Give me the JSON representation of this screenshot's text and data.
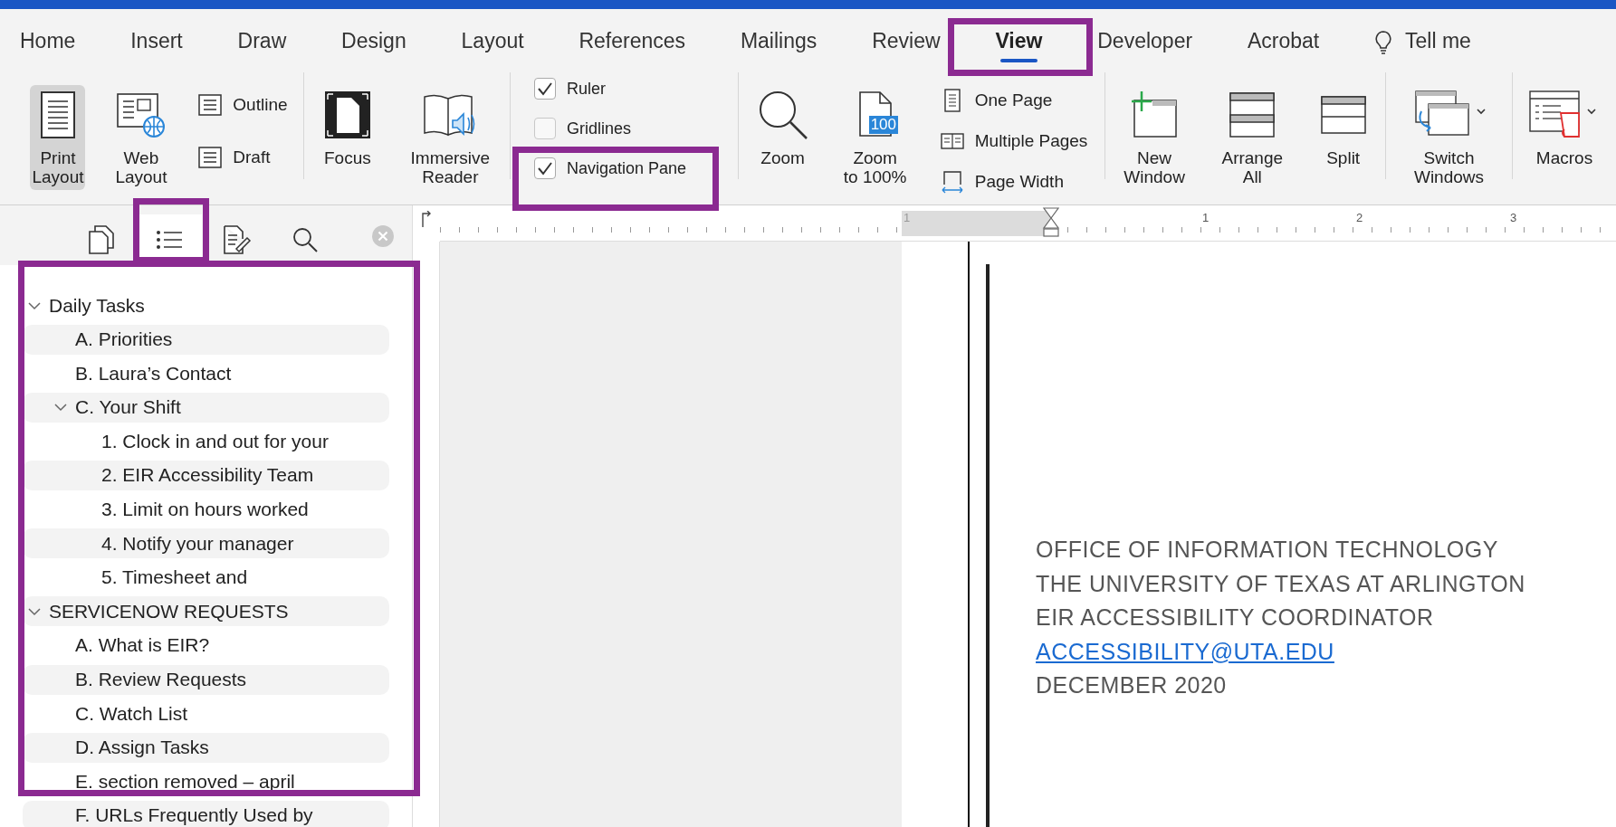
{
  "tabs": [
    {
      "label": "Home",
      "kind": "tab",
      "selected": false
    },
    {
      "label": "Insert",
      "kind": "tab",
      "selected": false
    },
    {
      "label": "Draw",
      "kind": "tab",
      "selected": false
    },
    {
      "label": "Design",
      "kind": "tab",
      "selected": false
    },
    {
      "label": "Layout",
      "kind": "tab",
      "selected": false
    },
    {
      "label": "References",
      "kind": "tab",
      "selected": false
    },
    {
      "label": "Mailings",
      "kind": "tab",
      "selected": false
    },
    {
      "label": "Review",
      "kind": "tab",
      "selected": false
    },
    {
      "label": "View",
      "kind": "tab",
      "selected": true
    },
    {
      "label": "Developer",
      "kind": "tab",
      "selected": false
    },
    {
      "label": "Acrobat",
      "kind": "tab",
      "selected": false
    },
    {
      "label": "Tell me",
      "kind": "tell-me",
      "selected": false
    }
  ],
  "ribbon": {
    "views": [
      {
        "lines": [
          "Print",
          "Layout"
        ],
        "selected": true
      },
      {
        "lines": [
          "Web",
          "Layout"
        ],
        "selected": false
      }
    ],
    "view_small": [
      {
        "label": "Outline",
        "selected": false
      },
      {
        "label": "Draft",
        "selected": false
      }
    ],
    "immersive": [
      {
        "lines": [
          "Focus"
        ]
      },
      {
        "lines": [
          "Immersive",
          "Reader"
        ]
      }
    ],
    "show": [
      {
        "label": "Ruler",
        "checked": true
      },
      {
        "label": "Gridlines",
        "checked": false
      },
      {
        "label": "Navigation Pane",
        "checked": true
      }
    ],
    "zoom": [
      {
        "lines": [
          "Zoom"
        ]
      },
      {
        "lines": [
          "Zoom",
          "to 100%"
        ],
        "badge": "100"
      }
    ],
    "zoom_small": [
      {
        "label": "One Page"
      },
      {
        "label": "Multiple Pages"
      },
      {
        "label": "Page Width"
      }
    ],
    "window": [
      {
        "lines": [
          "New",
          "Window"
        ]
      },
      {
        "lines": [
          "Arrange",
          "All"
        ]
      },
      {
        "lines": [
          "Split"
        ]
      }
    ],
    "switch": {
      "lines": [
        "Switch",
        "Windows"
      ]
    },
    "macros": {
      "lines": [
        "Macros"
      ]
    }
  },
  "nav_pane": {
    "tabs": [
      {
        "selected": false
      },
      {
        "selected": true
      },
      {
        "selected": false
      },
      {
        "selected": false
      }
    ],
    "headings": [
      {
        "text": "Daily Tasks",
        "expanded": true,
        "children": [
          {
            "text": "A. Priorities"
          },
          {
            "text": "B. Laura’s Contact"
          },
          {
            "text": "C. Your Shift",
            "expanded": true,
            "children": [
              {
                "text": "1. Clock in and out for your"
              },
              {
                "text": "2. EIR Accessibility Team"
              },
              {
                "text": "3. Limit on hours worked"
              },
              {
                "text": "4. Notify your manager"
              },
              {
                "text": "5. Timesheet and"
              }
            ]
          }
        ]
      },
      {
        "text": "SERVICENOW REQUESTS",
        "expanded": true,
        "children": [
          {
            "text": "A. What is EIR?"
          },
          {
            "text": "B. Review Requests"
          },
          {
            "text": "C. Watch List"
          },
          {
            "text": "D. Assign Tasks"
          },
          {
            "text": "E. section removed – april"
          },
          {
            "text": "F. URLs Frequently Used by"
          }
        ]
      }
    ]
  },
  "ruler": {
    "labels": [
      "1",
      "1",
      "2",
      "3"
    ]
  },
  "document": {
    "lines": [
      {
        "text": "OFFICE OF INFORMATION TECHNOLOGY",
        "kind": "text"
      },
      {
        "text": "THE UNIVERSITY OF TEXAS AT ARLINGTON",
        "kind": "text"
      },
      {
        "text": "EIR ACCESSIBILITY COORDINATOR",
        "kind": "text"
      },
      {
        "text": "ACCESSIBILITY@UTA.EDU",
        "kind": "link"
      },
      {
        "text": "DECEMBER 2020",
        "kind": "text"
      }
    ]
  }
}
